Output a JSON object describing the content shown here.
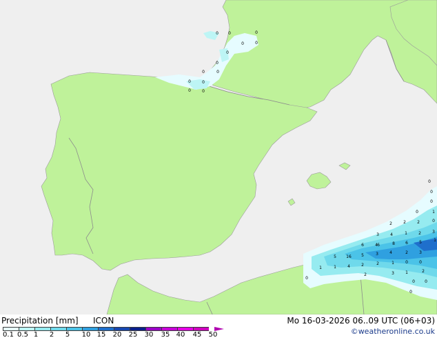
{
  "header": {
    "title": "Precipitation [mm]",
    "model": "ICON",
    "datetime": "Mo 16-03-2026 06..09 UTC (06+03)",
    "credit": "©weatheronline.co.uk"
  },
  "colors": {
    "sea": "#efefef",
    "land": "#bff29a",
    "border": "#8c8c8c"
  },
  "legend": {
    "ticks": [
      "0.1",
      "0.5",
      "1",
      "2",
      "5",
      "10",
      "15",
      "20",
      "25",
      "30",
      "35",
      "40",
      "45",
      "50"
    ],
    "colors": [
      "#e6fcff",
      "#bdf5f5",
      "#96ebf0",
      "#6fd9eb",
      "#4bc3e8",
      "#2fa0e0",
      "#1f6fcc",
      "#1747b0",
      "#0a1f8c",
      "#9b00c8",
      "#c800d8",
      "#e600e6",
      "#d000c0"
    ]
  },
  "cell_values": [
    "0",
    "0",
    "0",
    "0",
    "0",
    "0",
    "0",
    "0",
    "0",
    "0",
    "0",
    "0",
    "0",
    "0",
    "0",
    "0",
    "0",
    "1",
    "2",
    "2",
    "0",
    "2",
    "3",
    "4",
    "1",
    "2",
    "3",
    "6",
    "8",
    "6",
    "5",
    "1",
    "6",
    "4",
    "5",
    "16",
    "5",
    "3",
    "4",
    "2",
    "3",
    "1",
    "1",
    "4",
    "2",
    "2",
    "1",
    "0",
    "0",
    "2",
    "3",
    "1",
    "2",
    "0",
    "0",
    "0",
    "0"
  ]
}
